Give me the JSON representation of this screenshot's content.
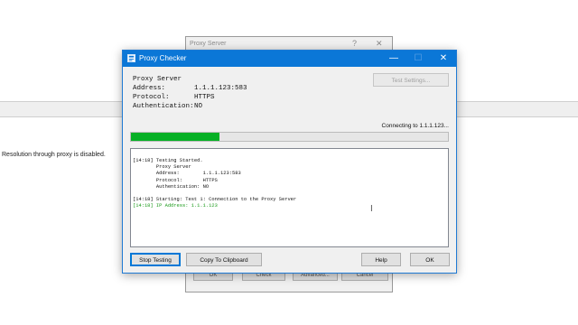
{
  "background": {
    "message": "Resolution through proxy is disabled.",
    "dialog": {
      "title": "Proxy Server",
      "help_glyph": "?",
      "close_glyph": "✕",
      "buttons": [
        "OK",
        "Check",
        "Advanced...",
        "Cancel"
      ]
    }
  },
  "window": {
    "title": "Proxy Checker",
    "icon": "proxy-checker-app-icon",
    "minimize_glyph": "—",
    "maximize_glyph": "☐",
    "close_glyph": "✕"
  },
  "info": {
    "heading": "Proxy Server",
    "address_label": "Address:",
    "address_value": "1.1.1.123:583",
    "protocol_label": "Protocol:",
    "protocol_value": "HTTPS",
    "auth_label": "Authentication:",
    "auth_value": "NO"
  },
  "test_settings_label": "Test Settings...",
  "status_text": "Connecting to 1.1.1.123...",
  "progress_percent": 28,
  "log_lines": [
    "[14:18] Testing Started.",
    "        Proxy Server",
    "        Address:        1.1.1.123:583",
    "        Protocol:       HTTPS",
    "        Authentication: NO",
    "",
    "[14:18] Starting: Test 1: Connection to the Proxy Server",
    "[14:18] IP Address: 1.1.1.123"
  ],
  "buttons": {
    "stop_testing": "Stop Testing",
    "copy_clipboard": "Copy To Clipboard",
    "help": "Help",
    "ok": "OK"
  },
  "colors": {
    "titlebar": "#0b77d7",
    "progress": "#06b025",
    "log_success": "#1a9a1a"
  }
}
